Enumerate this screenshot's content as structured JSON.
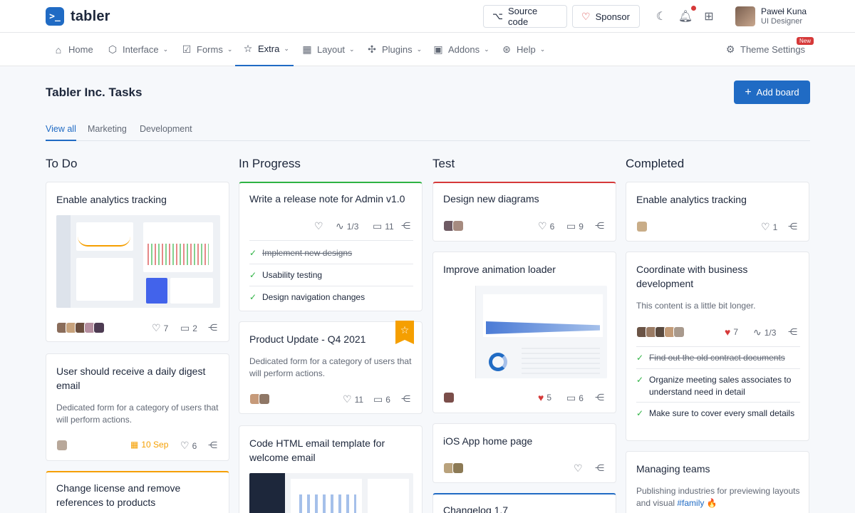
{
  "app": {
    "name": "tabler",
    "logo_glyph": ">_"
  },
  "header": {
    "source_code": "Source code",
    "sponsor": "Sponsor",
    "user": {
      "name": "Paweł Kuna",
      "role": "UI Designer"
    }
  },
  "nav": {
    "items": [
      "Home",
      "Interface",
      "Forms",
      "Extra",
      "Layout",
      "Plugins",
      "Addons",
      "Help"
    ],
    "theme_settings": "Theme Settings",
    "new_badge": "New"
  },
  "page": {
    "title": "Tabler Inc. Tasks",
    "add_board": "Add board",
    "tabs": [
      "View all",
      "Marketing",
      "Development"
    ]
  },
  "columns": {
    "todo": "To Do",
    "progress": "In Progress",
    "test": "Test",
    "completed": "Completed"
  },
  "cards": {
    "todo1": {
      "title": "Enable analytics tracking",
      "likes": "7",
      "comments": "2"
    },
    "todo2": {
      "title": "User should receive a daily digest email",
      "text": "Dedicated form for a category of users that will perform actions.",
      "date": "10 Sep",
      "likes": "6"
    },
    "todo3": {
      "title": "Change license and remove references to products"
    },
    "prog1": {
      "title": "Write a release note for Admin v1.0",
      "tasks": "1/3",
      "comments": "11",
      "checks": [
        "Implement new designs",
        "Usability testing",
        "Design navigation changes"
      ]
    },
    "prog2": {
      "title": "Product Update - Q4 2021",
      "text": "Dedicated form for a category of users that will perform actions.",
      "likes": "11",
      "comments": "6"
    },
    "prog3": {
      "title": "Code HTML email template for welcome email"
    },
    "test1": {
      "title": "Design new diagrams",
      "likes": "6",
      "comments": "9"
    },
    "test2": {
      "title": "Improve animation loader",
      "likes": "5",
      "comments": "6"
    },
    "test3": {
      "title": "iOS App home page"
    },
    "test4": {
      "title": "Changelog 1.7"
    },
    "comp1": {
      "title": "Enable analytics tracking",
      "likes": "1"
    },
    "comp2": {
      "title": "Coordinate with business development",
      "text": "This content is a little bit longer.",
      "likes": "7",
      "tasks": "1/3",
      "checks": [
        "Find out the old contract documents",
        "Organize meeting sales associates to understand need in detail",
        "Make sure to cover every small details"
      ]
    },
    "comp3": {
      "title": "Managing teams",
      "text_prefix": "Publishing industries for previewing layouts and visual ",
      "hashtag": "#family",
      "emoji": "🔥"
    }
  },
  "colors": {
    "primary": "#206bc4",
    "danger": "#d63939",
    "warning": "#f59f00",
    "success": "#2fb344"
  }
}
